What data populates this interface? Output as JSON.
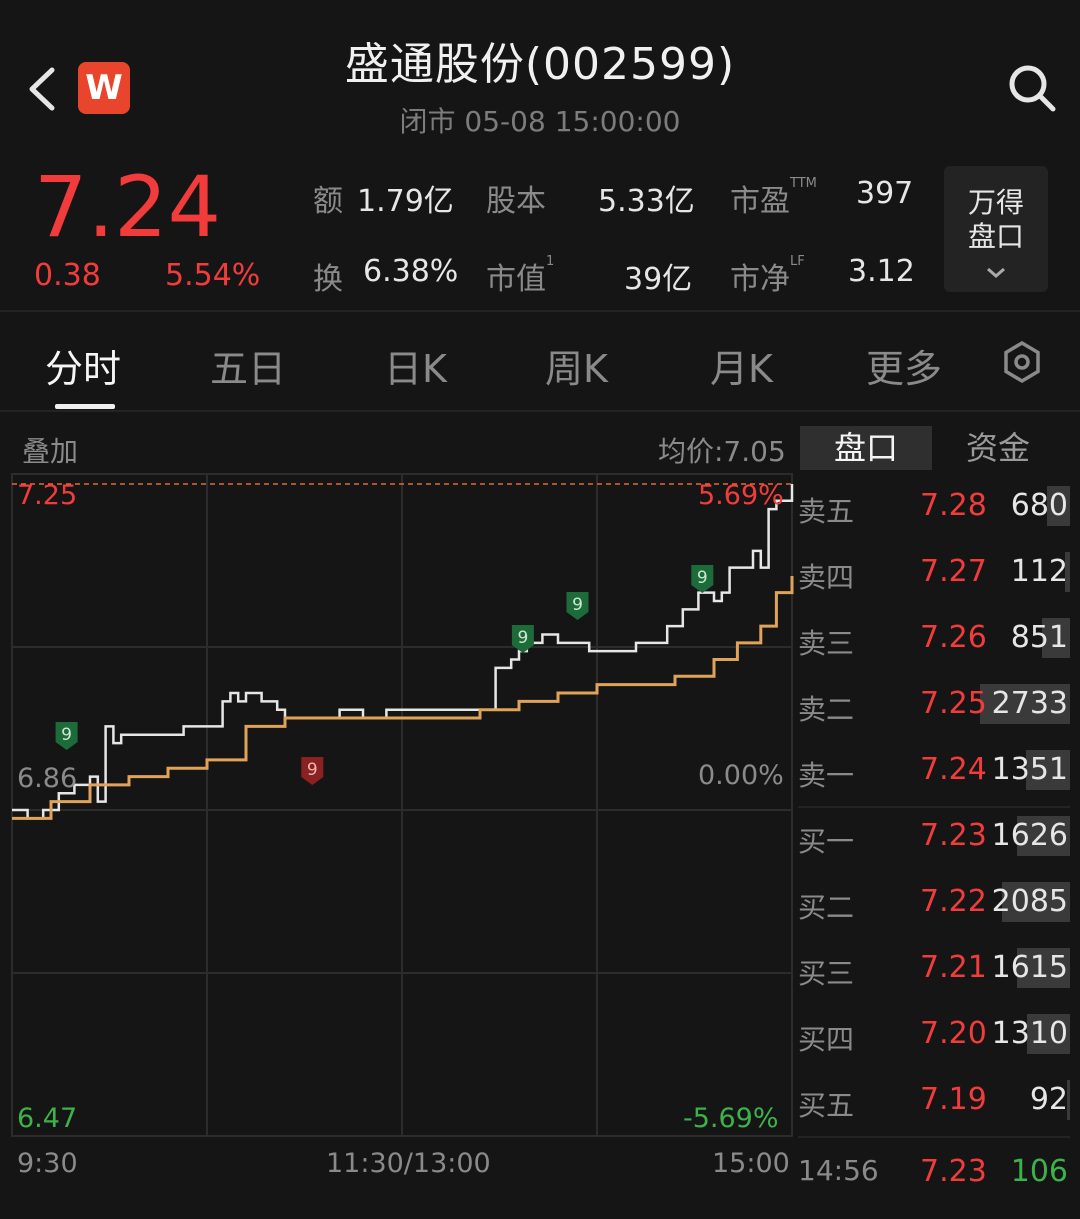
{
  "header": {
    "title": "盛通股份(002599)",
    "subtitle": "闭市  05-08 15:00:00",
    "logo_text": "W"
  },
  "quote": {
    "price": "7.24",
    "change": "0.38",
    "change_pct": "5.54%",
    "stats": {
      "amount_label": "额",
      "amount_value": "1.79亿",
      "shares_label": "股本",
      "shares_value": "5.33亿",
      "pe_label": "市盈",
      "pe_sup": "TTM",
      "pe_value": "397",
      "turnover_label": "换",
      "turnover_value": "6.38%",
      "mktcap_label": "市值",
      "mktcap_sup": "1",
      "mktcap_value": "39亿",
      "pb_label": "市净",
      "pb_sup": "LF",
      "pb_value": "3.12"
    },
    "pankou_button": {
      "line1": "万得",
      "line2": "盘口"
    }
  },
  "tabs": [
    "分时",
    "五日",
    "日K",
    "周K",
    "月K",
    "更多"
  ],
  "chart": {
    "overlay_label": "叠加",
    "avg_label": "均价:7.05",
    "y_top": "7.25",
    "y_mid": "6.86",
    "y_bottom": "6.47",
    "pct_top": "5.69%",
    "pct_mid": "0.00%",
    "pct_bottom": "-5.69%",
    "x_labels": [
      "9:30",
      "11:30/13:00",
      "15:00"
    ],
    "signal_label": "9"
  },
  "chart_data": {
    "type": "line",
    "ylim": [
      6.47,
      7.25
    ],
    "x_labels": [
      "9:30",
      "11:30/13:00",
      "15:00"
    ],
    "series": [
      {
        "name": "price",
        "color": "#e6e6e6",
        "x": [
          0,
          0.02,
          0.04,
          0.06,
          0.08,
          0.1,
          0.11,
          0.12,
          0.13,
          0.14,
          0.15,
          0.17,
          0.2,
          0.22,
          0.24,
          0.26,
          0.27,
          0.28,
          0.29,
          0.3,
          0.32,
          0.34,
          0.35,
          0.38,
          0.4,
          0.42,
          0.45,
          0.48,
          0.5,
          0.52,
          0.55,
          0.58,
          0.6,
          0.62,
          0.64,
          0.65,
          0.66,
          0.67,
          0.68,
          0.7,
          0.72,
          0.74,
          0.76,
          0.78,
          0.8,
          0.82,
          0.84,
          0.86,
          0.88,
          0.9,
          0.91,
          0.92,
          0.94,
          0.95,
          0.96,
          0.97,
          0.98,
          1.0
        ],
        "values": [
          6.86,
          6.85,
          6.86,
          6.88,
          6.89,
          6.9,
          6.87,
          6.96,
          6.94,
          6.95,
          6.95,
          6.95,
          6.95,
          6.96,
          6.96,
          6.96,
          6.99,
          7.0,
          6.99,
          7.0,
          6.99,
          6.98,
          6.97,
          6.97,
          6.97,
          6.98,
          6.97,
          6.98,
          6.98,
          6.98,
          6.98,
          6.98,
          6.98,
          7.03,
          7.04,
          7.05,
          7.06,
          7.06,
          7.07,
          7.06,
          7.06,
          7.05,
          7.05,
          7.05,
          7.06,
          7.06,
          7.08,
          7.1,
          7.12,
          7.11,
          7.12,
          7.15,
          7.15,
          7.17,
          7.15,
          7.22,
          7.23,
          7.25
        ]
      },
      {
        "name": "avg",
        "color": "#e0a35a",
        "x": [
          0,
          0.05,
          0.1,
          0.15,
          0.2,
          0.25,
          0.3,
          0.35,
          0.4,
          0.45,
          0.5,
          0.55,
          0.6,
          0.65,
          0.7,
          0.75,
          0.8,
          0.85,
          0.9,
          0.93,
          0.96,
          0.98,
          1.0
        ],
        "values": [
          6.85,
          6.87,
          6.89,
          6.9,
          6.91,
          6.92,
          6.96,
          6.97,
          6.97,
          6.97,
          6.97,
          6.97,
          6.98,
          6.99,
          7.0,
          7.01,
          7.01,
          7.02,
          7.04,
          7.06,
          7.08,
          7.12,
          7.14
        ]
      }
    ]
  },
  "orderbook": {
    "tab_active": "盘口",
    "tab_other": "资金",
    "asks": [
      {
        "name": "卖五",
        "price": "7.28",
        "vol": "680",
        "bar": 0.25
      },
      {
        "name": "卖四",
        "price": "7.27",
        "vol": "112",
        "bar": 0.05
      },
      {
        "name": "卖三",
        "price": "7.26",
        "vol": "851",
        "bar": 0.31
      },
      {
        "name": "卖二",
        "price": "7.25",
        "vol": "2733",
        "bar": 1.0
      },
      {
        "name": "卖一",
        "price": "7.24",
        "vol": "1351",
        "bar": 0.49
      }
    ],
    "bids": [
      {
        "name": "买一",
        "price": "7.23",
        "vol": "1626",
        "bar": 0.59
      },
      {
        "name": "买二",
        "price": "7.22",
        "vol": "2085",
        "bar": 0.76
      },
      {
        "name": "买三",
        "price": "7.21",
        "vol": "1615",
        "bar": 0.59
      },
      {
        "name": "买四",
        "price": "7.20",
        "vol": "1310",
        "bar": 0.48
      },
      {
        "name": "买五",
        "price": "7.19",
        "vol": "92",
        "bar": 0.03
      }
    ],
    "last_trade": {
      "time": "14:56",
      "price": "7.23",
      "vol": "106"
    }
  },
  "colors": {
    "up": "#f23c3c",
    "down": "#3bb24a",
    "avg": "#e0a35a",
    "bg": "#151515"
  }
}
